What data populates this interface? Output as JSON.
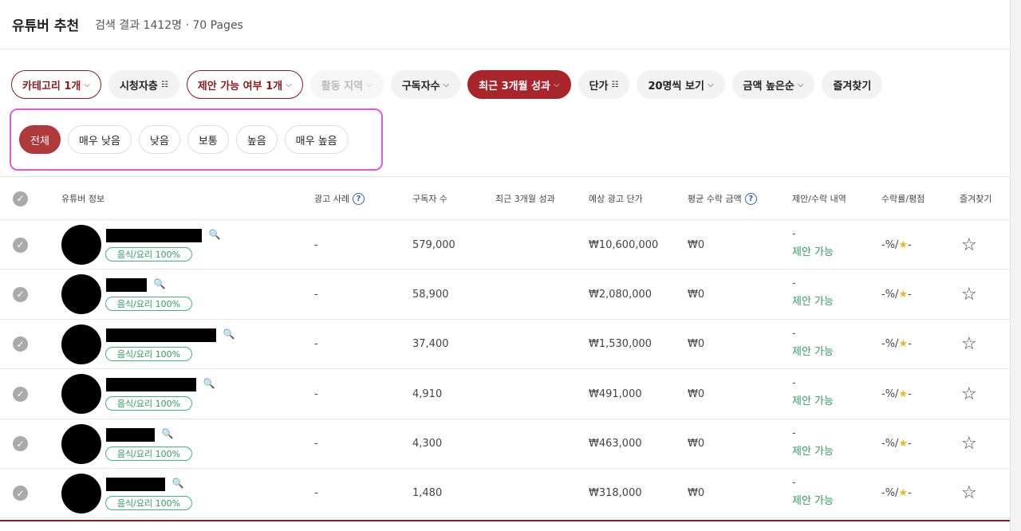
{
  "header": {
    "title": "유튜버 추천",
    "result_summary": "검색 결과 1412명 · 70 Pages"
  },
  "filters": [
    {
      "label": "카테고리 1개",
      "style": "outline",
      "icon": "chevron-down"
    },
    {
      "label": "시청자층",
      "style": "gray",
      "icon": "sliders"
    },
    {
      "label": "제안 가능 여부 1개",
      "style": "outline",
      "icon": "chevron-down"
    },
    {
      "label": "활동 지역",
      "style": "disabled",
      "icon": "chevron-down"
    },
    {
      "label": "구독자수",
      "style": "gray",
      "icon": "chevron-down"
    },
    {
      "label": "최근 3개월 성과",
      "style": "solid",
      "icon": "chevron-down"
    },
    {
      "label": "단가",
      "style": "gray",
      "icon": "sliders"
    },
    {
      "label": "20명씩 보기",
      "style": "gray",
      "icon": "chevron-down"
    },
    {
      "label": "금액 높은순",
      "style": "gray",
      "icon": "chevron-down"
    },
    {
      "label": "즐겨찾기",
      "style": "gray",
      "icon": ""
    }
  ],
  "levels": [
    {
      "label": "전체",
      "active": true
    },
    {
      "label": "매우 낮음",
      "active": false
    },
    {
      "label": "낮음",
      "active": false
    },
    {
      "label": "보통",
      "active": false
    },
    {
      "label": "높음",
      "active": false
    },
    {
      "label": "매우 높음",
      "active": false
    }
  ],
  "table": {
    "columns": {
      "info": "유튜버 정보",
      "ad_cases": "광고 사례",
      "subscribers": "구독자 수",
      "recent_perf": "최근 3개월 성과",
      "ad_price": "예상 광고 단가",
      "avg_revenue": "평균 수락 금액",
      "proposal": "제안/수락 내역",
      "acceptance": "수락률/평점",
      "favorite": "즐겨찾기"
    },
    "rows": [
      {
        "category": "음식/요리 100%",
        "ad_cases": "-",
        "subscribers": "579,000",
        "ad_price": "₩10,600,000",
        "avg_revenue": "₩0",
        "proposal_dash": "-",
        "proposal_status": "제안 가능",
        "rate_prefix": "-%/",
        "rate_star": "★",
        "rate_suffix": "-"
      },
      {
        "category": "음식/요리 100%",
        "ad_cases": "-",
        "subscribers": "58,900",
        "ad_price": "₩2,080,000",
        "avg_revenue": "₩0",
        "proposal_dash": "-",
        "proposal_status": "제안 가능",
        "rate_prefix": "-%/",
        "rate_star": "★",
        "rate_suffix": "-"
      },
      {
        "category": "음식/요리 100%",
        "ad_cases": "-",
        "subscribers": "37,400",
        "ad_price": "₩1,530,000",
        "avg_revenue": "₩0",
        "proposal_dash": "-",
        "proposal_status": "제안 가능",
        "rate_prefix": "-%/",
        "rate_star": "★",
        "rate_suffix": "-"
      },
      {
        "category": "음식/요리 100%",
        "ad_cases": "-",
        "subscribers": "4,910",
        "ad_price": "₩491,000",
        "avg_revenue": "₩0",
        "proposal_dash": "-",
        "proposal_status": "제안 가능",
        "rate_prefix": "-%/",
        "rate_star": "★",
        "rate_suffix": "-"
      },
      {
        "category": "음식/요리 100%",
        "ad_cases": "-",
        "subscribers": "4,300",
        "ad_price": "₩463,000",
        "avg_revenue": "₩0",
        "proposal_dash": "-",
        "proposal_status": "제안 가능",
        "rate_prefix": "-%/",
        "rate_star": "★",
        "rate_suffix": "-"
      },
      {
        "category": "음식/요리 100%",
        "ad_cases": "-",
        "subscribers": "1,480",
        "ad_price": "₩318,000",
        "avg_revenue": "₩0",
        "proposal_dash": "-",
        "proposal_status": "제안 가능",
        "rate_prefix": "-%/",
        "rate_star": "★",
        "rate_suffix": "-"
      }
    ]
  },
  "colors": {
    "accent": "#a8262b",
    "highlight_box": "#e657e6",
    "tag_green": "#3cba6f",
    "star_yellow": "#e8b923"
  }
}
